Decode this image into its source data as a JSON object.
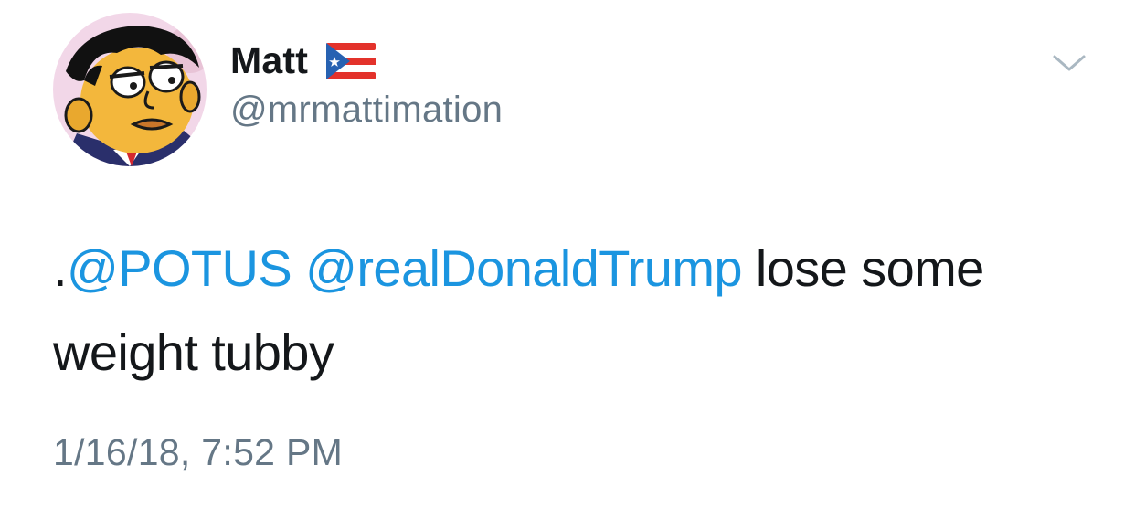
{
  "tweet": {
    "author": {
      "display_name": "Matt",
      "handle": "@mrmattimation",
      "flag_icon": "puerto-rico-flag-icon",
      "avatar_icon": "cartoon-avatar"
    },
    "menu_icon": "chevron-down-icon",
    "text": {
      "prefix": ".",
      "mention_1": "@POTUS",
      "separator": " ",
      "mention_2": "@realDonaldTrump",
      "body": " lose some weight tubby"
    },
    "timestamp": "1/16/18, 7:52 PM"
  },
  "colors": {
    "mention": "#1b95e0",
    "secondary_text": "#657786",
    "primary_text": "#14171a",
    "background": "#ffffff"
  }
}
